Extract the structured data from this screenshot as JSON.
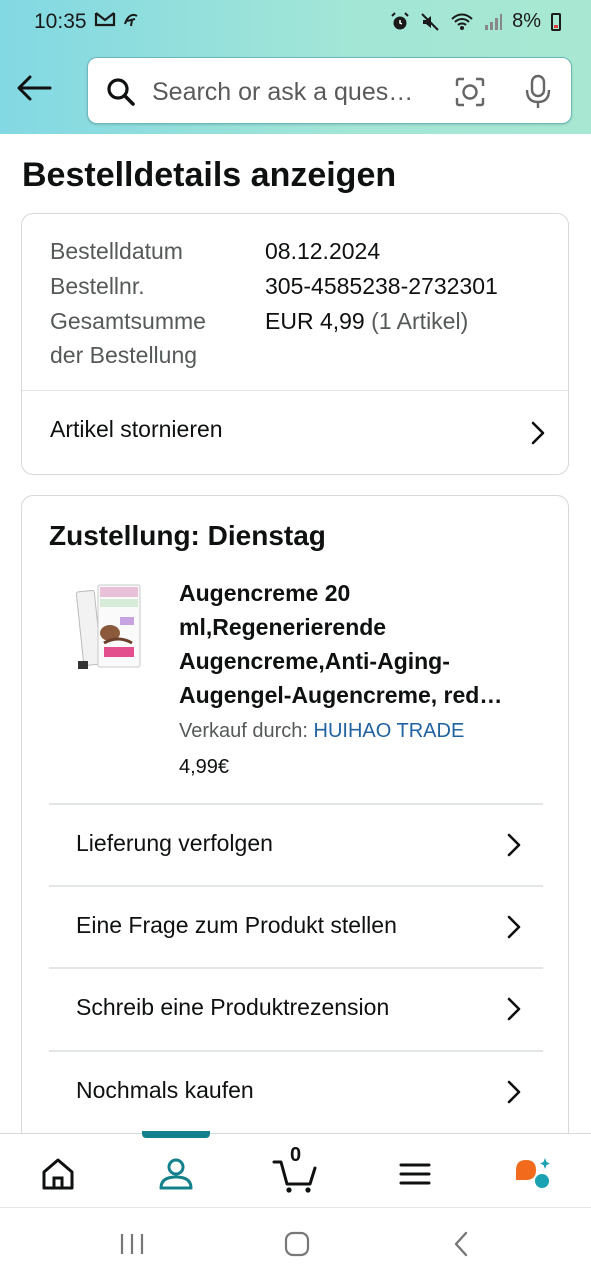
{
  "status_bar": {
    "time": "10:35",
    "battery": "8%"
  },
  "search": {
    "placeholder": "Search or ask a ques…"
  },
  "page": {
    "title": "Bestelldetails anzeigen"
  },
  "order_summary": {
    "date_label": "Bestelldatum",
    "date_value": "08.12.2024",
    "number_label": "Bestellnr.",
    "number_value": "305-4585238-2732301",
    "total_label_line1": "Gesamtsumme",
    "total_label_line2": "der Bestellung",
    "total_value": "EUR 4,99",
    "total_items": "(1 Artikel)",
    "cancel_label": "Artikel stornieren"
  },
  "delivery": {
    "title": "Zustellung: Dienstag",
    "product_title": "Augencreme 20 ml,Regenerierende Augencreme,Anti-Aging-Augengel-Augencreme, red…",
    "seller_label": "Verkauf durch:",
    "seller_name": "HUIHAO TRADE",
    "price": "4,99€",
    "actions": [
      {
        "label": "Lieferung verfolgen"
      },
      {
        "label": "Eine Frage zum Produkt stellen"
      },
      {
        "label": "Schreib eine Produktrezension"
      },
      {
        "label": "Nochmals kaufen"
      }
    ]
  },
  "bottom_nav": {
    "cart_count": "0",
    "active_tab": "account"
  },
  "colors": {
    "accent_teal": "#13818b",
    "link_blue": "#2162a1",
    "header_gradient_start": "#82d8e3",
    "header_gradient_end": "#a8e8d2",
    "rufus_orange": "#f26b1d",
    "rufus_teal": "#1aa2b3"
  }
}
